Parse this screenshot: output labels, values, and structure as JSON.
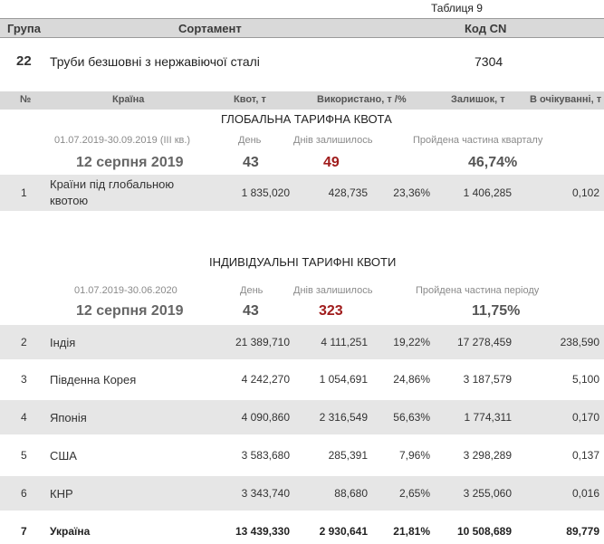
{
  "table_number": "Таблиця 9",
  "header": {
    "group": "Група",
    "assortment": "Сортамент",
    "code": "Код CN"
  },
  "product": {
    "group": "22",
    "name": "Труби безшовні з нержавіючої сталі",
    "code": "7304"
  },
  "columns": {
    "num": "№",
    "country": "Країна",
    "quota": "Квот, т",
    "used": "Використано, т /%",
    "remaining": "Залишок, т",
    "expected": "В очікуванні, т"
  },
  "global_quota": {
    "title": "ГЛОБАЛЬНА ТАРИФНА КВОТА",
    "period": "01.07.2019-30.09.2019  (ІІІ кв.)",
    "day_label": "День",
    "days_left_label": "Днів залишилось",
    "progress_label": "Пройдена частина кварталу",
    "date": "12 серпня 2019",
    "day": "43",
    "days_left": "49",
    "progress": "46,74%",
    "rows": [
      {
        "num": "1",
        "country_line1": "Країни під глобальною",
        "country_line2": "квотою",
        "quota": "1 835,020",
        "used": "428,735",
        "pct": "23,36%",
        "remaining": "1 406,285",
        "expected": "0,102"
      }
    ]
  },
  "individual_quota": {
    "title": "ІНДИВІДУАЛЬНІ ТАРИФНІ КВОТИ",
    "period": "01.07.2019-30.06.2020",
    "day_label": "День",
    "days_left_label": "Днів залишилось",
    "progress_label": "Пройдена частина періоду",
    "date": "12 серпня 2019",
    "day": "43",
    "days_left": "323",
    "progress": "11,75%",
    "rows": [
      {
        "num": "2",
        "country": "Індія",
        "quota": "21 389,710",
        "used": "4 111,251",
        "pct": "19,22%",
        "remaining": "17 278,459",
        "expected": "238,590"
      },
      {
        "num": "3",
        "country": "Південна Корея",
        "quota": "4 242,270",
        "used": "1 054,691",
        "pct": "24,86%",
        "remaining": "3 187,579",
        "expected": "5,100"
      },
      {
        "num": "4",
        "country": "Японія",
        "quota": "4 090,860",
        "used": "2 316,549",
        "pct": "56,63%",
        "remaining": "1 774,311",
        "expected": "0,170"
      },
      {
        "num": "5",
        "country": "США",
        "quota": "3 583,680",
        "used": "285,391",
        "pct": "7,96%",
        "remaining": "3 298,289",
        "expected": "0,137"
      },
      {
        "num": "6",
        "country": "КНР",
        "quota": "3 343,740",
        "used": "88,680",
        "pct": "2,65%",
        "remaining": "3 255,060",
        "expected": "0,016"
      },
      {
        "num": "7",
        "country": "Україна",
        "quota": "13 439,330",
        "used": "2 930,641",
        "pct": "21,81%",
        "remaining": "10 508,689",
        "expected": "89,779"
      }
    ]
  }
}
